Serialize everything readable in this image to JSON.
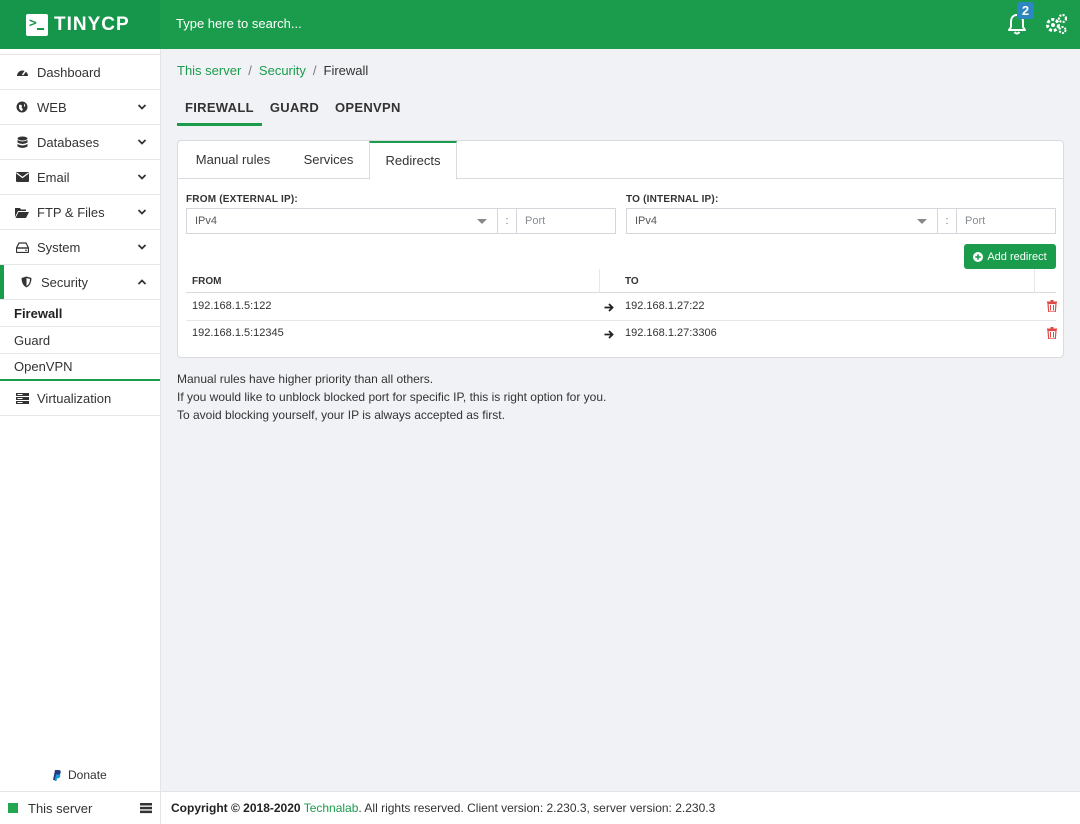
{
  "header": {
    "logo_text": "TINYCP",
    "search_placeholder": "Type here to search...",
    "notification_count": "2"
  },
  "sidebar": {
    "items": [
      {
        "label": "Dashboard",
        "icon": "dashboard-icon"
      },
      {
        "label": "WEB",
        "icon": "globe-icon"
      },
      {
        "label": "Databases",
        "icon": "database-icon"
      },
      {
        "label": "Email",
        "icon": "envelope-icon"
      },
      {
        "label": "FTP & Files",
        "icon": "folder-icon"
      },
      {
        "label": "System",
        "icon": "hard-drive-icon"
      },
      {
        "label": "Security",
        "icon": "shield-icon"
      },
      {
        "label": "Virtualization",
        "icon": "server-icon"
      }
    ],
    "security_sub": [
      "Firewall",
      "Guard",
      "OpenVPN"
    ],
    "donate_label": "Donate",
    "server_label": "This server"
  },
  "breadcrumb": {
    "items": [
      "This server",
      "Security",
      "Firewall"
    ],
    "separator": "/"
  },
  "top_tabs": [
    "FIREWALL",
    "GUARD",
    "OPENVPN"
  ],
  "sub_tabs": [
    "Manual rules",
    "Services",
    "Redirects"
  ],
  "form": {
    "from_label": "FROM (EXTERNAL IP):",
    "to_label": "TO (INTERNAL IP):",
    "ip_placeholder": "IPv4",
    "colon": ":",
    "port_placeholder": "Port",
    "add_button": "Add redirect"
  },
  "table": {
    "headers": [
      "FROM",
      "TO"
    ],
    "rows": [
      {
        "from": "192.168.1.5:122",
        "to": "192.168.1.27:22"
      },
      {
        "from": "192.168.1.5:12345",
        "to": "192.168.1.27:3306"
      }
    ]
  },
  "notes": [
    "Manual rules have higher priority than all others.",
    "If you would like to unblock blocked port for specific IP, this is right option for you.",
    "To avoid blocking yourself, your IP is always accepted as first."
  ],
  "footer": {
    "copyright": "Copyright © 2018-2020",
    "company": "Technalab",
    "rest": ". All rights reserved. Client version: 2.230.3, server version: 2.230.3"
  },
  "colors": {
    "brand_green": "#1a9c4c",
    "badge_blue": "#2e86c1",
    "delete_red": "#e04848"
  }
}
